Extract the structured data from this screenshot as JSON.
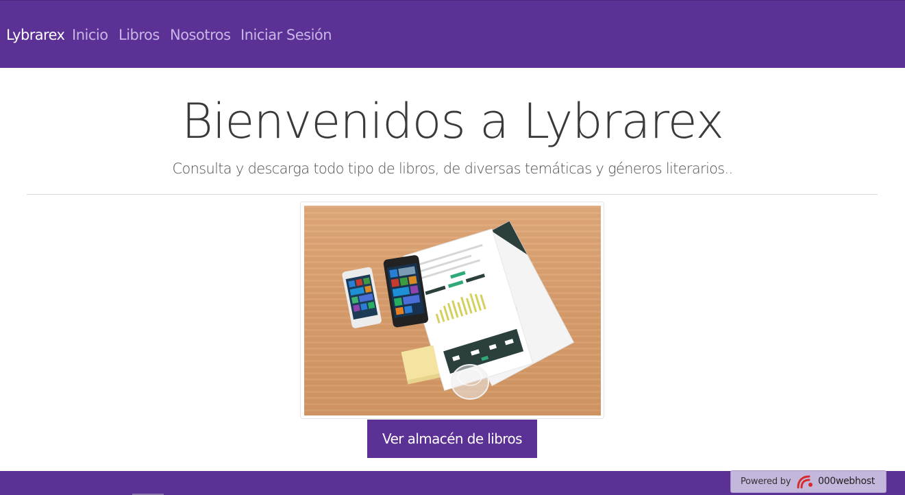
{
  "navbar": {
    "brand": "Lybrarex",
    "links": [
      {
        "label": "Inicio"
      },
      {
        "label": "Libros"
      },
      {
        "label": "Nosotros"
      },
      {
        "label": "Iniciar Sesión"
      }
    ]
  },
  "hero": {
    "title": "Bienvenidos a Lybrarex",
    "subtitle": "Consulta y descarga todo tipo de libros, de diversas temáticas y géneros literarios.."
  },
  "cta": {
    "label": "Ver almacén de libros"
  },
  "powered": {
    "label": "Powered by",
    "brand": "000webhost"
  },
  "colors": {
    "primary": "#5b3196",
    "nav_link": "#c9b6e6",
    "title_text": "#3a3a3a"
  }
}
